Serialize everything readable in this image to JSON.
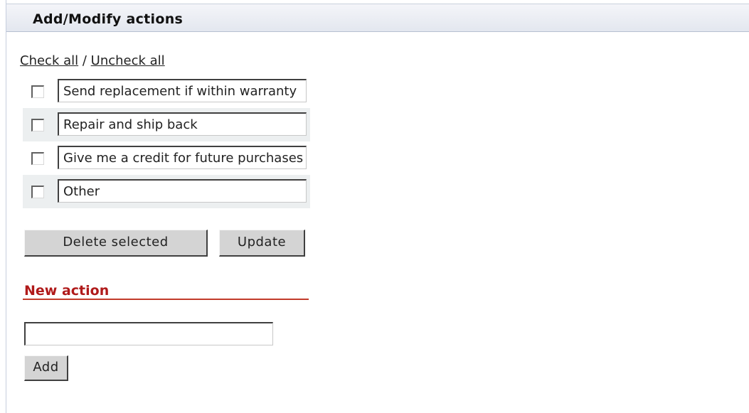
{
  "panel": {
    "title": "Add/Modify actions"
  },
  "check_links": {
    "check_all": "Check all",
    "separator": " / ",
    "uncheck_all": "Uncheck all"
  },
  "actions": [
    {
      "value": "Send replacement if within warranty",
      "checked": false
    },
    {
      "value": "Repair and ship back",
      "checked": false
    },
    {
      "value": "Give me a credit for future purchases",
      "checked": false
    },
    {
      "value": "Other",
      "checked": false
    }
  ],
  "buttons": {
    "delete_selected": "Delete selected",
    "update": "Update"
  },
  "new_action": {
    "heading": "New action",
    "input_value": "",
    "add_label": "Add"
  },
  "colors": {
    "section_heading": "#b01a1a",
    "header_bg": "#e3e7ef",
    "row_shade": "#eceff0"
  }
}
